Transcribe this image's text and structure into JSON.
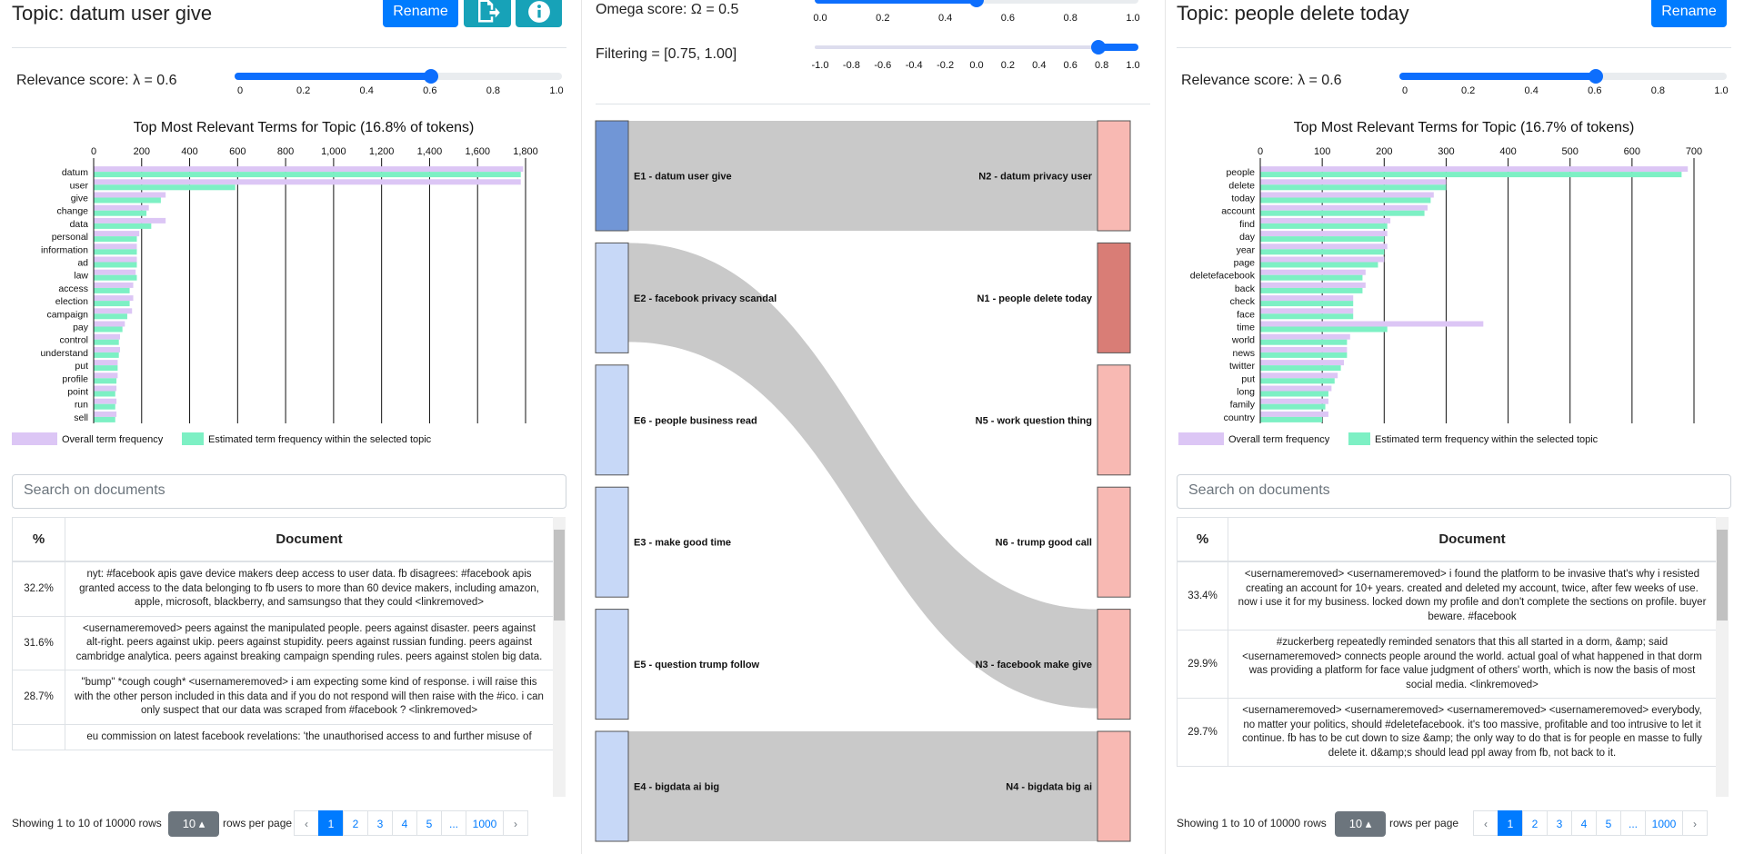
{
  "left": {
    "title": "Topic: datum user give",
    "rename_label": "Rename",
    "relevance_label": "Relevance score: λ = 0.6",
    "relevance_value": 0.6,
    "slider_ticks": [
      "0",
      "0.2",
      "0.4",
      "0.6",
      "0.8",
      "1.0"
    ],
    "search_placeholder": "Search on documents",
    "table_headers": {
      "pct": "%",
      "doc": "Document"
    },
    "rows": [
      {
        "pct": "32.2%",
        "text": "nyt: #facebook apis gave device makers deep access to user data. fb disagrees: #facebook apis granted access to the data belonging to fb users to more than 60 device makers, including amazon, apple, microsoft, blackberry, and samsungso that they could <linkremoved>"
      },
      {
        "pct": "31.6%",
        "text": "<usernameremoved> peers against the manipulated people. peers against disaster. peers against alt-right. peers against ukip. peers against stupidity. peers against russian funding. peers against cambridge analytica. peers against breaking campaign spending rules. peers against stolen big data."
      },
      {
        "pct": "28.7%",
        "text": "\"bump\" *cough cough* <usernameremoved> i am expecting some kind of response. i will raise this with the other person included in this data and if you do not respond will then raise with the #ico. i can only suspect that our data was scraped from #facebook ? <linkremoved>"
      },
      {
        "pct": "",
        "text": "eu commission on latest facebook revelations: 'the unauthorised access to and further misuse of"
      }
    ],
    "showing": "Showing 1 to 10 of 10000 rows",
    "rows_per_page": "10",
    "rows_per_page_label": "rows per page",
    "pages": [
      "‹",
      "1",
      "2",
      "3",
      "4",
      "5",
      "...",
      "1000",
      "›"
    ],
    "active_page": "1"
  },
  "right": {
    "title": "Topic: people delete today",
    "rename_label": "Rename",
    "relevance_label": "Relevance score: λ = 0.6",
    "relevance_value": 0.6,
    "slider_ticks": [
      "0",
      "0.2",
      "0.4",
      "0.6",
      "0.8",
      "1.0"
    ],
    "search_placeholder": "Search on documents",
    "table_headers": {
      "pct": "%",
      "doc": "Document"
    },
    "rows": [
      {
        "pct": "33.4%",
        "text": "<usernameremoved> <usernameremoved> i found the platform to be invasive that's why i resisted creating an account for 10+ years. created and deleted my account, twice, after few weeks of use. now i use it for my business. locked down my profile and don't complete the sections on profile. buyer beware. #facebook"
      },
      {
        "pct": "29.9%",
        "text": "#zuckerberg repeatedly reminded senators that this all started in a dorm, &amp; said <usernameremoved> connects people around the world. actual goal of what happened in that dorm was providing a platform for face value judgment of others' worth, which is now the basis of most social media. <linkremoved>"
      },
      {
        "pct": "29.7%",
        "text": "<usernameremoved> <usernameremoved> <usernameremoved> <usernameremoved> everybody, no matter your politics, should #deletefacebook. it's too massive, profitable and too intrusive to let it continue. fb has to be cut down to size &amp; the only way to do that is for people en masse to fully delete it. d&amp;s should lead ppl away from fb, not back to it."
      }
    ],
    "showing": "Showing 1 to 10 of 10000 rows",
    "rows_per_page": "10",
    "rows_per_page_label": "rows per page",
    "pages": [
      "‹",
      "1",
      "2",
      "3",
      "4",
      "5",
      "...",
      "1000",
      "›"
    ],
    "active_page": "1"
  },
  "middle": {
    "omega_label": "Omega score: Ω = 0.5",
    "omega_value": 0.5,
    "omega_ticks": [
      "0.0",
      "0.2",
      "0.4",
      "0.6",
      "0.8",
      "1.0"
    ],
    "filter_label": "Filtering = [0.75, 1.00]",
    "filter_range": [
      0.75,
      1.0
    ],
    "filter_ticks": [
      "-1.0",
      "-0.8",
      "-0.6",
      "-0.4",
      "-0.2",
      "0.0",
      "0.2",
      "0.4",
      "0.6",
      "0.8",
      "1.0"
    ],
    "left_nodes": [
      "E1 - datum user give",
      "E2 - facebook privacy scandal",
      "E6 - people business read",
      "E3 - make good time",
      "E5 - question trump follow",
      "E4 - bigdata ai big"
    ],
    "right_nodes": [
      "N2 - datum privacy user",
      "N1 - people delete today",
      "N5 - work question thing",
      "N6 - trump good call",
      "N3 - facebook make give",
      "N4 - bigdata big ai"
    ],
    "links": [
      {
        "from": "E1 - datum user give",
        "to": "N2 - datum privacy user"
      },
      {
        "from": "E2 - facebook privacy scandal",
        "to": "N3 - facebook make give"
      },
      {
        "from": "E4 - bigdata ai big",
        "to": "N4 - bigdata big ai"
      }
    ],
    "colors": {
      "selected_left": "#7196d6",
      "left": "#c7d8f7",
      "selected_right": "#d97d76",
      "right": "#f8b9b3",
      "link": "#c9c9c9"
    }
  },
  "chart_data": [
    {
      "type": "bar",
      "title": "Top Most Relevant Terms for Topic (16.8% of tokens)",
      "categories": [
        "datum",
        "user",
        "give",
        "change",
        "data",
        "personal",
        "information",
        "ad",
        "law",
        "access",
        "election",
        "campaign",
        "pay",
        "control",
        "understand",
        "put",
        "profile",
        "point",
        "run",
        "sell"
      ],
      "series": [
        {
          "name": "Overall term frequency",
          "values": [
            1790,
            1780,
            300,
            230,
            300,
            190,
            180,
            180,
            175,
            165,
            165,
            160,
            130,
            110,
            110,
            100,
            100,
            95,
            95,
            95
          ]
        },
        {
          "name": "Estimated term frequency within the selected topic",
          "values": [
            1780,
            590,
            280,
            220,
            240,
            180,
            180,
            180,
            180,
            150,
            150,
            140,
            120,
            105,
            105,
            100,
            95,
            90,
            90,
            90
          ]
        }
      ],
      "xlim": [
        0,
        1800
      ],
      "xticks": [
        "0",
        "200",
        "400",
        "600",
        "800",
        "1,000",
        "1,200",
        "1,400",
        "1,600",
        "1,800"
      ],
      "colors": [
        "#dcc6f5",
        "#7df0c4"
      ],
      "legend_placement": "bottom",
      "grid": true
    },
    {
      "type": "bar",
      "title": "Top Most Relevant Terms for Topic (16.7% of tokens)",
      "categories": [
        "people",
        "delete",
        "today",
        "account",
        "find",
        "day",
        "year",
        "page",
        "deletefacebook",
        "back",
        "check",
        "face",
        "time",
        "world",
        "news",
        "twitter",
        "put",
        "long",
        "family",
        "country"
      ],
      "series": [
        {
          "name": "Overall term frequency",
          "values": [
            690,
            300,
            280,
            270,
            210,
            205,
            205,
            200,
            170,
            170,
            150,
            150,
            360,
            145,
            140,
            135,
            125,
            115,
            110,
            110
          ]
        },
        {
          "name": "Estimated term frequency within the selected topic",
          "values": [
            680,
            300,
            275,
            265,
            205,
            200,
            200,
            190,
            165,
            165,
            150,
            150,
            205,
            140,
            140,
            130,
            120,
            110,
            105,
            100
          ]
        }
      ],
      "xlim": [
        0,
        700
      ],
      "xticks": [
        "0",
        "100",
        "200",
        "300",
        "400",
        "500",
        "600",
        "700"
      ],
      "colors": [
        "#dcc6f5",
        "#7df0c4"
      ],
      "legend_placement": "bottom",
      "grid": true
    }
  ]
}
